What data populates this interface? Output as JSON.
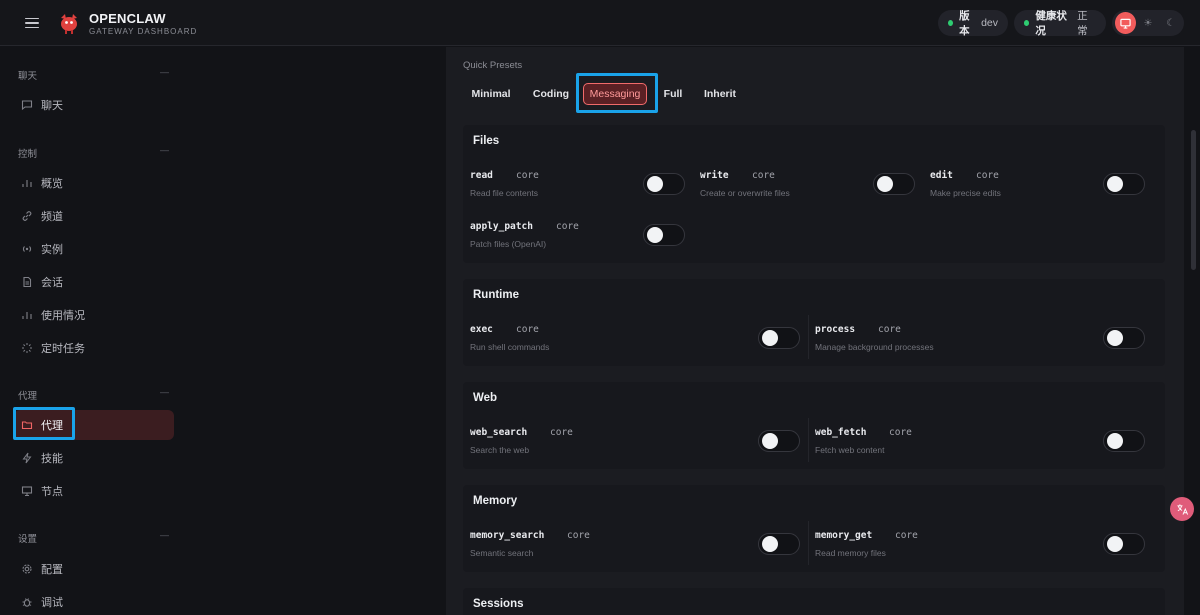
{
  "header": {
    "brand_title": "OPENCLAW",
    "brand_subtitle": "GATEWAY DASHBOARD",
    "version_label": "版本",
    "version_value": "dev",
    "health_label": "健康状况",
    "health_value": "正常",
    "status_color": "#2ecc71",
    "accent_color": "#f25c5c",
    "theme_icons": [
      "monitor-icon",
      "sun-icon",
      "moon-icon"
    ]
  },
  "sidebar": {
    "groups": [
      {
        "label": "聊天",
        "items": [
          {
            "label": "聊天",
            "icon": "message-icon"
          }
        ]
      },
      {
        "label": "控制",
        "items": [
          {
            "label": "概览",
            "icon": "bar-chart-icon"
          },
          {
            "label": "频道",
            "icon": "link-icon"
          },
          {
            "label": "实例",
            "icon": "radio-icon"
          },
          {
            "label": "会话",
            "icon": "file-icon"
          },
          {
            "label": "使用情况",
            "icon": "bar-chart-icon"
          },
          {
            "label": "定时任务",
            "icon": "loader-icon"
          }
        ]
      },
      {
        "label": "代理",
        "items": [
          {
            "label": "代理",
            "icon": "folder-icon",
            "active": true
          },
          {
            "label": "技能",
            "icon": "zap-icon"
          },
          {
            "label": "节点",
            "icon": "monitor-icon"
          }
        ]
      },
      {
        "label": "设置",
        "items": [
          {
            "label": "配置",
            "icon": "gear-icon"
          },
          {
            "label": "调试",
            "icon": "bug-icon"
          }
        ]
      }
    ]
  },
  "presets": {
    "label": "Quick Presets",
    "options": [
      "Minimal",
      "Coding",
      "Messaging",
      "Full",
      "Inherit"
    ],
    "active": "Messaging"
  },
  "sections": [
    {
      "title": "Files",
      "tools": [
        {
          "name": "read",
          "tag": "core",
          "desc": "Read file contents",
          "enabled": false
        },
        {
          "name": "write",
          "tag": "core",
          "desc": "Create or overwrite files",
          "enabled": false
        },
        {
          "name": "edit",
          "tag": "core",
          "desc": "Make precise edits",
          "enabled": false
        },
        {
          "name": "apply_patch",
          "tag": "core",
          "desc": "Patch files (OpenAI)",
          "enabled": false
        }
      ]
    },
    {
      "title": "Runtime",
      "tools": [
        {
          "name": "exec",
          "tag": "core",
          "desc": "Run shell commands",
          "enabled": false
        },
        {
          "name": "process",
          "tag": "core",
          "desc": "Manage background processes",
          "enabled": false
        }
      ]
    },
    {
      "title": "Web",
      "tools": [
        {
          "name": "web_search",
          "tag": "core",
          "desc": "Search the web",
          "enabled": false
        },
        {
          "name": "web_fetch",
          "tag": "core",
          "desc": "Fetch web content",
          "enabled": false
        }
      ]
    },
    {
      "title": "Memory",
      "tools": [
        {
          "name": "memory_search",
          "tag": "core",
          "desc": "Semantic search",
          "enabled": false
        },
        {
          "name": "memory_get",
          "tag": "core",
          "desc": "Read memory files",
          "enabled": false
        }
      ]
    },
    {
      "title": "Sessions",
      "tools": []
    }
  ]
}
